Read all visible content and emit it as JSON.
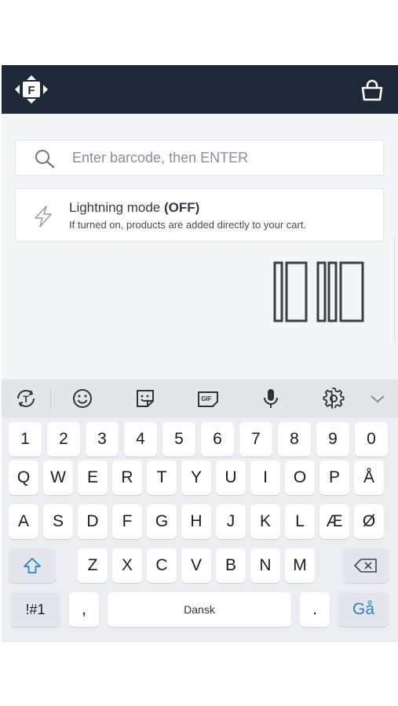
{
  "header": {
    "logo_icon": "logo-f-diamond-icon",
    "logo_letter": "F",
    "cart_icon": "shopping-bag-icon",
    "background_color": "#1f2837"
  },
  "search": {
    "placeholder": "Enter barcode, then ENTER",
    "value": "",
    "icon": "search-icon"
  },
  "lightning": {
    "icon": "lightning-bolt-icon",
    "label": "Lightning mode",
    "state": "(OFF)",
    "description": "If turned on, products are added directly to your cart."
  },
  "barcode_illustration": "barcode-icon",
  "keyboard": {
    "toolbar": [
      "translate-icon",
      "emoji-icon",
      "sticker-icon",
      "gif-icon",
      "microphone-icon",
      "settings-icon",
      "chevron-down-icon"
    ],
    "rows": [
      [
        "1",
        "2",
        "3",
        "4",
        "5",
        "6",
        "7",
        "8",
        "9",
        "0"
      ],
      [
        "Q",
        "W",
        "E",
        "R",
        "T",
        "Y",
        "U",
        "I",
        "O",
        "P",
        "Å"
      ],
      [
        "A",
        "S",
        "D",
        "F",
        "G",
        "H",
        "J",
        "K",
        "L",
        "Æ",
        "Ø"
      ],
      [
        "Z",
        "X",
        "C",
        "V",
        "B",
        "N",
        "M"
      ]
    ],
    "symbols_label": "!#1",
    "comma": ",",
    "space_label": "Dansk",
    "period": ".",
    "action_label": "Gå",
    "accent_color": "#2f7fd3"
  }
}
